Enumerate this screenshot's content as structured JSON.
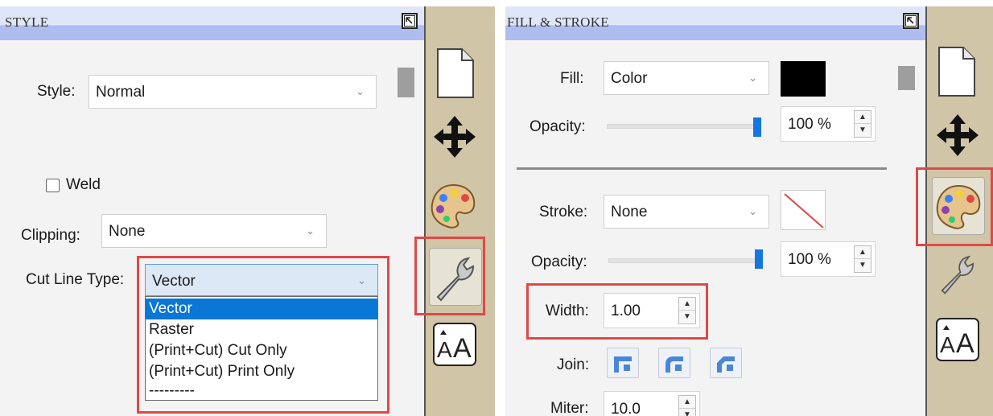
{
  "style_panel": {
    "title": "STYLE",
    "style_label": "Style:",
    "style_value": "Normal",
    "weld_label": "Weld",
    "clipping_label": "Clipping:",
    "clipping_value": "None",
    "cut_line_type_label": "Cut Line Type:",
    "cut_line_type_value": "Vector",
    "cut_line_type_options": [
      "Vector",
      "Raster",
      "(Print+Cut) Cut Only",
      "(Print+Cut) Print Only",
      "---------"
    ],
    "selected_option": "Vector"
  },
  "fill_stroke_panel": {
    "title": "FILL & STROKE",
    "fill_label": "Fill:",
    "fill_value": "Color",
    "fill_color": "#000000",
    "fill_opacity_label": "Opacity:",
    "fill_opacity_value": "100 %",
    "stroke_label": "Stroke:",
    "stroke_value": "None",
    "stroke_opacity_label": "Opacity:",
    "stroke_opacity_value": "100 %",
    "width_label": "Width:",
    "width_value": "1.00",
    "join_label": "Join:",
    "miter_label": "Miter:",
    "miter_value": "10.0"
  },
  "dock_icons": [
    "page-icon",
    "move-icon",
    "palette-icon",
    "wrench-icon",
    "text-size-icon"
  ],
  "colors": {
    "header_band": "#aebdf0",
    "dock_background": "#d0c5a6",
    "highlight_red": "#e04848",
    "selection_blue": "#0a76d6",
    "slider_blue": "#1476e0"
  }
}
